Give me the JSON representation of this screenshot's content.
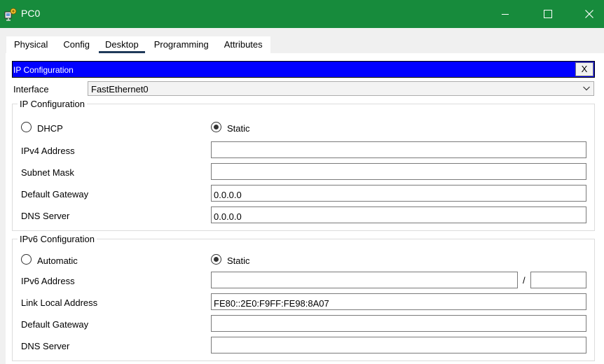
{
  "window": {
    "title": "PC0",
    "icon": "packet-tracer-pc-icon",
    "controls": [
      "minimize-icon",
      "maximize-icon",
      "close-icon"
    ]
  },
  "tabs": [
    {
      "label": "Physical",
      "active": false
    },
    {
      "label": "Config",
      "active": false
    },
    {
      "label": "Desktop",
      "active": true
    },
    {
      "label": "Programming",
      "active": false
    },
    {
      "label": "Attributes",
      "active": false
    }
  ],
  "ip_config": {
    "header_title": "IP Configuration",
    "close_label": "X",
    "header_color": "#0000ff",
    "interface_label": "Interface",
    "interface_value": "FastEthernet0",
    "ipv4": {
      "group_title": "IP Configuration",
      "dhcp_label": "DHCP",
      "static_label": "Static",
      "mode": "Static",
      "ipv4_address_label": "IPv4 Address",
      "ipv4_address_value": "",
      "subnet_mask_label": "Subnet Mask",
      "subnet_mask_value": "",
      "default_gateway_label": "Default Gateway",
      "default_gateway_value": "0.0.0.0",
      "dns_server_label": "DNS Server",
      "dns_server_value": "0.0.0.0"
    },
    "ipv6": {
      "group_title": "IPv6 Configuration",
      "automatic_label": "Automatic",
      "static_label": "Static",
      "mode": "Static",
      "ipv6_address_label": "IPv6 Address",
      "ipv6_address_value": "",
      "prefix_separator": "/",
      "prefix_value": "",
      "link_local_label": "Link Local Address",
      "link_local_value": "FE80::2E0:F9FF:FE98:8A07",
      "default_gateway_label": "Default Gateway",
      "default_gateway_value": "",
      "dns_server_label": "DNS Server",
      "dns_server_value": ""
    }
  },
  "colors": {
    "titlebar": "#178b3c",
    "active_tab_underline": "#1f3a5a"
  }
}
